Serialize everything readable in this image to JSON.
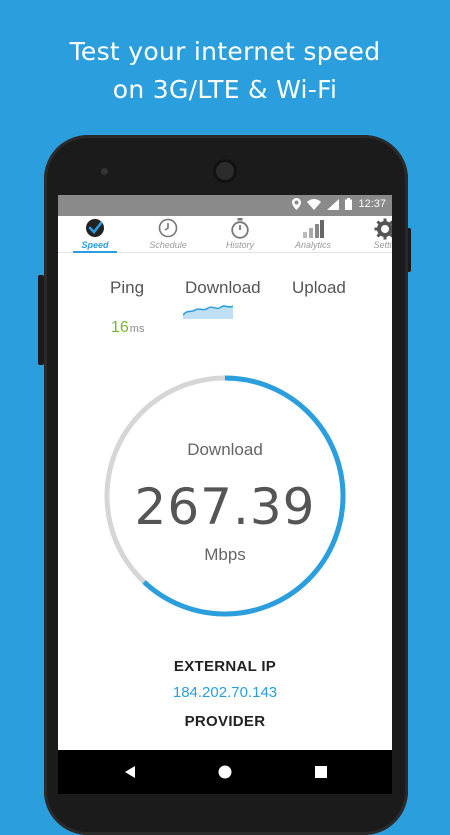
{
  "headline": {
    "line1": "Test your internet speed",
    "line2": "on 3G/LTE & Wi-Fi"
  },
  "statusbar": {
    "time": "12:37",
    "icons": [
      "location-icon",
      "wifi-icon",
      "signal-icon",
      "battery-icon"
    ]
  },
  "tabs": [
    {
      "label": "Speed",
      "icon": "speedometer-check-icon",
      "active": true
    },
    {
      "label": "Schedule",
      "icon": "clock-icon",
      "active": false
    },
    {
      "label": "History",
      "icon": "stopwatch-icon",
      "active": false
    },
    {
      "label": "Analytics",
      "icon": "bar-chart-icon",
      "active": false
    },
    {
      "label": "Settin",
      "icon": "gear-icon",
      "active": false
    }
  ],
  "metrics": {
    "ping_label": "Ping",
    "download_label": "Download",
    "upload_label": "Upload",
    "ping_value": "16",
    "ping_unit": "ms"
  },
  "gauge": {
    "title": "Download",
    "value": "267.39",
    "unit": "Mbps",
    "progress": 0.62
  },
  "info": {
    "external_ip_label": "EXTERNAL IP",
    "external_ip_value": "184.202.70.143",
    "provider_label": "PROVIDER"
  },
  "colors": {
    "accent": "#2b9fde",
    "ping": "#7ab52f",
    "track": "#d6d6d6"
  }
}
